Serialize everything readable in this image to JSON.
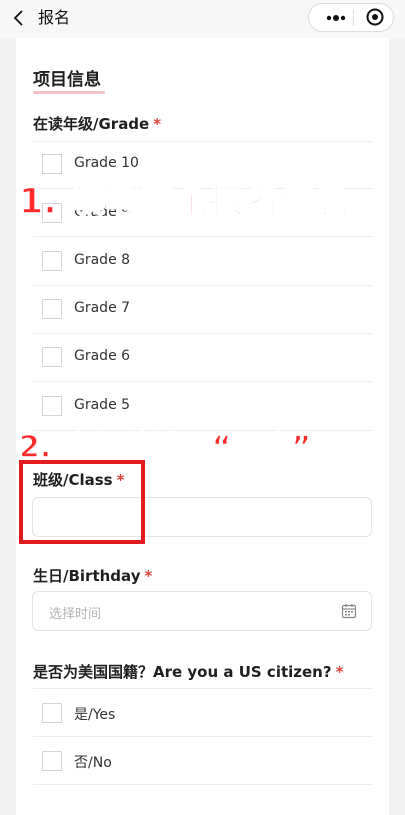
{
  "header": {
    "title": "报名"
  },
  "form": {
    "section_title": "项目信息",
    "grade_label": "在读年级/Grade",
    "required_mark": "*",
    "grade_options": [
      "Grade 10",
      "Grade 9",
      "Grade 8",
      "Grade 7",
      "Grade 6",
      "Grade 5"
    ],
    "class_label": "班级/Class",
    "class_value": "",
    "birthday_label": "生日/Birthday",
    "birthday_placeholder": "选择时间",
    "citizen_label": "是否为美国国籍？Are you a US citizen?",
    "citizen_options": [
      "是/Yes",
      "否/No"
    ]
  },
  "annotations": {
    "step1": "1. 填写其余报名信息",
    "step2": "2. 班级处填写“一班”"
  },
  "colors": {
    "accent_underline": "#f2c2c6",
    "annotation_red": "#ff2a2a"
  }
}
